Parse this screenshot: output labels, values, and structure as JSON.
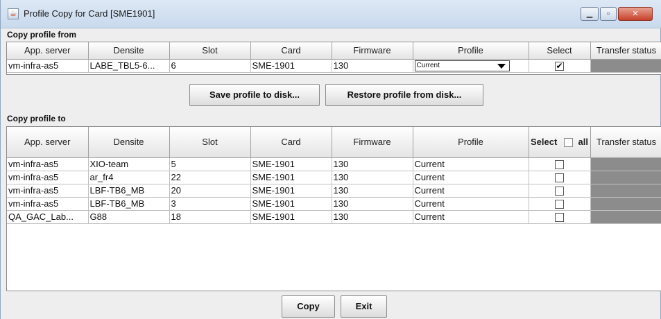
{
  "window": {
    "title": "Profile Copy for Card [SME1901]"
  },
  "copy_from": {
    "section_label": "Copy profile from",
    "columns": [
      "App. server",
      "Densite",
      "Slot",
      "Card",
      "Firmware",
      "Profile",
      "Select",
      "Transfer status"
    ],
    "row": {
      "app_server": "vm-infra-as5",
      "densite": "LABE_TBL5-6...",
      "slot": "6",
      "card": "SME-1901",
      "firmware": "130",
      "profile": "Current",
      "select_mark": "✔"
    }
  },
  "buttons": {
    "save_profile": "Save profile to disk...",
    "restore_profile": "Restore profile from disk...",
    "copy": "Copy",
    "exit": "Exit"
  },
  "copy_to": {
    "section_label": "Copy profile to",
    "columns": [
      "App. server",
      "Densite",
      "Slot",
      "Card",
      "Firmware",
      "Profile",
      "Select",
      "Transfer status"
    ],
    "select_all_label": "all",
    "rows": [
      {
        "app_server": "vm-infra-as5",
        "densite": "XIO-team",
        "slot": "5",
        "card": "SME-1901",
        "firmware": "130",
        "profile": "Current"
      },
      {
        "app_server": "vm-infra-as5",
        "densite": "ar_fr4",
        "slot": "22",
        "card": "SME-1901",
        "firmware": "130",
        "profile": "Current"
      },
      {
        "app_server": "vm-infra-as5",
        "densite": "LBF-TB6_MB",
        "slot": "20",
        "card": "SME-1901",
        "firmware": "130",
        "profile": "Current"
      },
      {
        "app_server": "vm-infra-as5",
        "densite": "LBF-TB6_MB",
        "slot": "3",
        "card": "SME-1901",
        "firmware": "130",
        "profile": "Current"
      },
      {
        "app_server": "QA_GAC_Lab...",
        "densite": "G88",
        "slot": "18",
        "card": "SME-1901",
        "firmware": "130",
        "profile": "Current"
      }
    ]
  }
}
